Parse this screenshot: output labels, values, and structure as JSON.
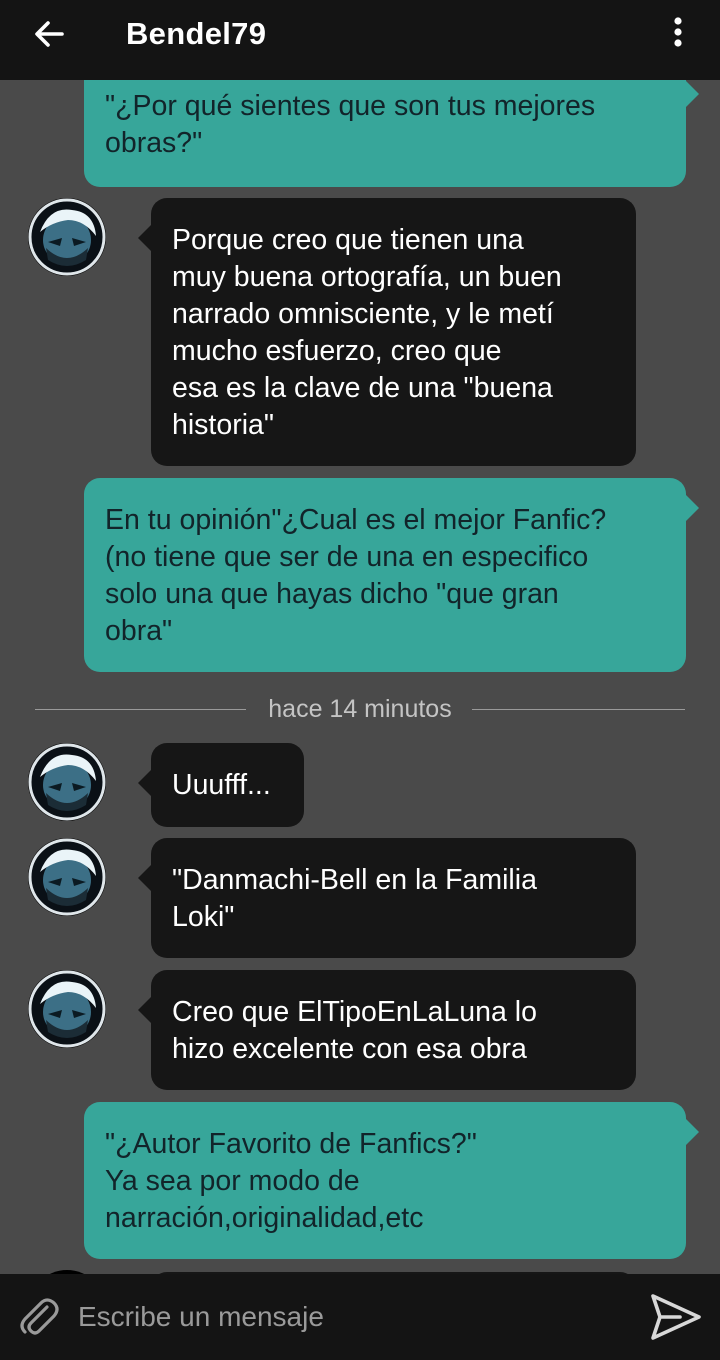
{
  "header": {
    "title": "Bendel79",
    "back_icon": "arrow-left-icon",
    "menu_icon": "more-vertical-icon"
  },
  "messages": [
    {
      "direction": "out",
      "text": "\"¿Por qué sientes que son tus mejores\nobras?\""
    },
    {
      "direction": "in",
      "text": "Porque creo que tienen una\nmuy buena ortografía, un buen\nnarrado omnisciente, y le metí\nmucho esfuerzo, creo que\nesa es la clave de una \"buena\nhistoria\""
    },
    {
      "direction": "out",
      "text": "En tu opinión\"¿Cual es el mejor Fanfic?\n(no tiene que ser de una en especifico\nsolo una que hayas dicho \"que gran\nobra\""
    },
    {
      "direction": "in",
      "text": "Uuufff..."
    },
    {
      "direction": "in",
      "text": "\"Danmachi-Bell en la Familia\nLoki\""
    },
    {
      "direction": "in",
      "text": "Creo que ElTipoEnLaLuna lo\nhizo excelente con esa obra"
    },
    {
      "direction": "out",
      "text": "\"¿Autor Favorito de Fanfics?\"\nYa sea por modo de\nnarración,originalidad,etc"
    }
  ],
  "timestamp_divider": "hace 14 minutos",
  "composer": {
    "placeholder": "Escribe un mensaje",
    "attach_icon": "paperclip-icon",
    "send_icon": "send-icon"
  },
  "colors": {
    "outgoing_bubble": "#37a69a",
    "incoming_bubble": "#161616",
    "background": "#4a4a4a",
    "bars": "#141414"
  }
}
